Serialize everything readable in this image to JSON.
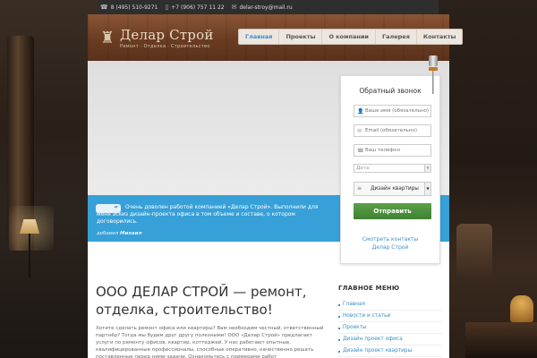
{
  "colors": {
    "accent_blue": "#37a0d8",
    "link_blue": "#3d8fc6",
    "submit_green": "#4a9140",
    "header_wood": "#7a4629",
    "top_bar": "#2e2e2e"
  },
  "top_bar": {
    "phone1": "8 (495) 510-9271",
    "phone2": "+7 (906) 757 11 22",
    "email": "delar-stroy@mail.ru",
    "icons": [
      "phone-icon",
      "mobile-icon",
      "mail-icon"
    ]
  },
  "header": {
    "logo_title": "Делар Строй",
    "logo_subtitle": "Ремонт · Отделка · Строительство"
  },
  "nav": {
    "items": [
      {
        "label": "Главная",
        "active": true
      },
      {
        "label": "Проекты",
        "active": false
      },
      {
        "label": "О компании",
        "active": false
      },
      {
        "label": "Галерея",
        "active": false
      },
      {
        "label": "Контакты",
        "active": false
      }
    ]
  },
  "callback": {
    "title": "Обратный звонок",
    "name_placeholder": "Ваше имя (обязательно)",
    "email_placeholder": "Email (обязательно)",
    "phone_placeholder": "Ваш телефон",
    "date_placeholder": "Дата",
    "type_value": "Дизайн квартиры",
    "submit_label": "Отправить",
    "contacts_link_line1": "Смотреть контакты",
    "contacts_link_line2": "Делар Строй"
  },
  "testimonial": {
    "text": "Очень доволен работой компанией «Делар Строй». Выполнили для меня эскиз дизайн-проекта офиса в том объеме и составе, о котором договорились.",
    "author_prefix": "добавил",
    "author_name": "Михаил"
  },
  "main": {
    "title": "ООО ДЕЛАР СТРОЙ — ремонт, отделка, строительство!",
    "intro": "Хотите сделать ремонт офиса или квартиры? Вам необходим честный, ответственный партнёр? Тогда мы будем друг другу полезными! ООО «Делар Строй» предлагает услуги по ремонту офисов, квартир, коттеджей. У нас работают опытные, квалифицированные профессионалы, способные оперативно, качественно решать поставленные перед ними задачи. Ознакомьтесь с примерами работ"
  },
  "sidebar_menu": {
    "title": "ГЛАВНОЕ МЕНЮ",
    "items": [
      {
        "label": "Главная"
      },
      {
        "label": "Новости и статьи"
      },
      {
        "label": "Проекты"
      },
      {
        "label": "Дизайн проект офиса"
      },
      {
        "label": "Дизайн проект квартиры"
      }
    ]
  }
}
